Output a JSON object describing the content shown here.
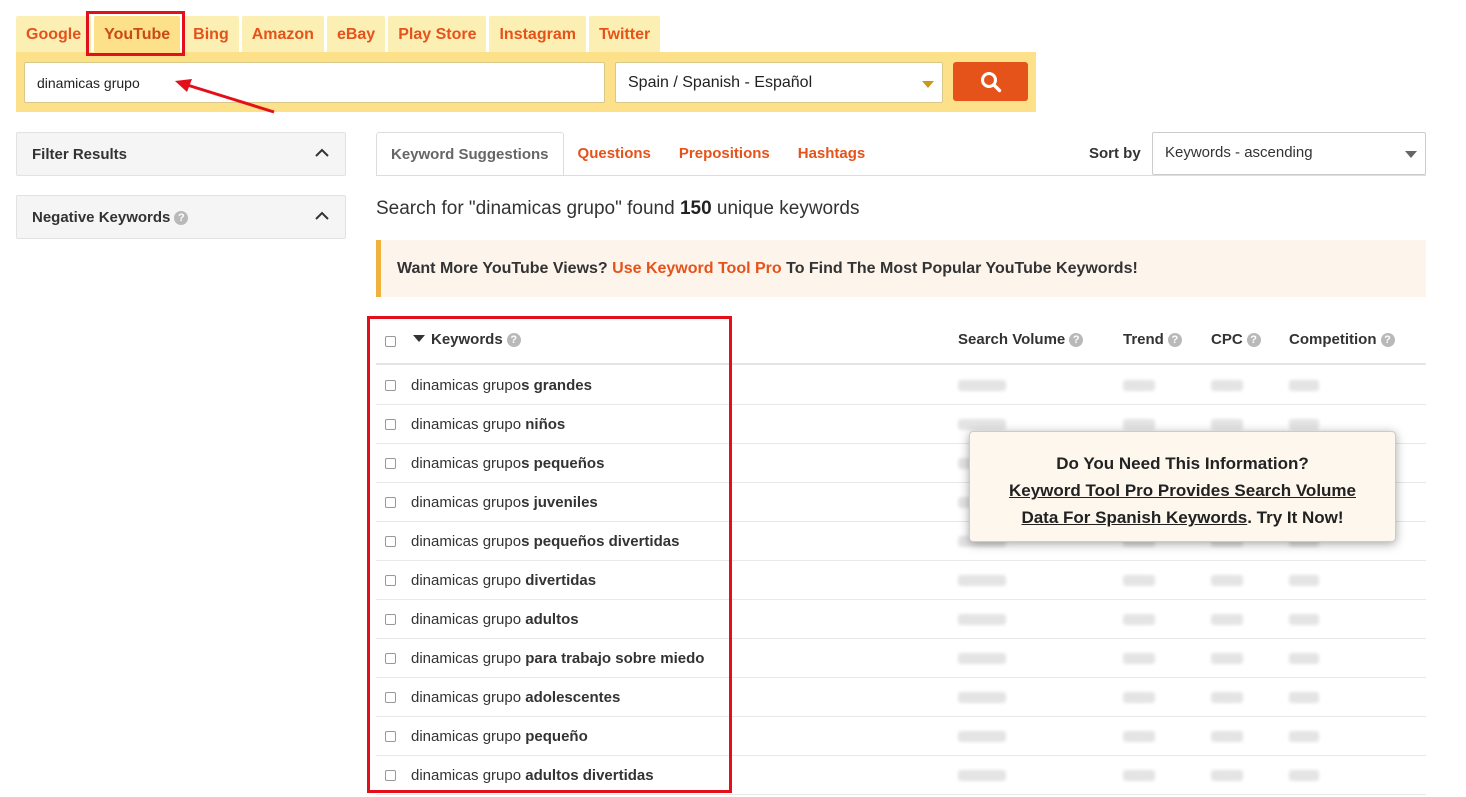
{
  "tabs": [
    "Google",
    "YouTube",
    "Bing",
    "Amazon",
    "eBay",
    "Play Store",
    "Instagram",
    "Twitter"
  ],
  "active_tab_index": 1,
  "search": {
    "value": "dinamicas grupo",
    "language": "Spain / Spanish - Español"
  },
  "sidebar": {
    "filter_title": "Filter Results",
    "negative_title": "Negative Keywords"
  },
  "result_tabs": [
    "Keyword Suggestions",
    "Questions",
    "Prepositions",
    "Hashtags"
  ],
  "sort": {
    "label": "Sort by",
    "value": "Keywords - ascending"
  },
  "found": {
    "prefix": "Search for \"dinamicas grupo\" found ",
    "count": "150",
    "suffix": " unique keywords"
  },
  "promo": {
    "text1": "Want More YouTube Views? ",
    "link": "Use Keyword Tool Pro",
    "text2": " To Find The Most Popular YouTube Keywords!"
  },
  "table": {
    "headers": {
      "keywords": "Keywords",
      "volume": "Search Volume",
      "trend": "Trend",
      "cpc": "CPC",
      "competition": "Competition"
    },
    "rows": [
      {
        "base": "dinamicas grupo",
        "bold": "s grandes"
      },
      {
        "base": "dinamicas grupo ",
        "bold": "niños"
      },
      {
        "base": "dinamicas grupo",
        "bold": "s pequeños"
      },
      {
        "base": "dinamicas grupo",
        "bold": "s juveniles"
      },
      {
        "base": "dinamicas grupo",
        "bold": "s pequeños divertidas"
      },
      {
        "base": "dinamicas grupo ",
        "bold": "divertidas"
      },
      {
        "base": "dinamicas grupo ",
        "bold": "adultos"
      },
      {
        "base": "dinamicas grupo ",
        "bold": "para trabajo sobre miedo"
      },
      {
        "base": "dinamicas grupo ",
        "bold": "adolescentes"
      },
      {
        "base": "dinamicas grupo ",
        "bold": "pequeño"
      },
      {
        "base": "dinamicas grupo ",
        "bold": "adultos divertidas"
      }
    ]
  },
  "popup": {
    "line1": "Do You Need This Information?",
    "line2": "Keyword Tool Pro Provides Search Volume",
    "line3_link": "Data For Spanish Keywords",
    "line3_rest": ". Try It Now!"
  },
  "colors": {
    "accent": "#e5531b",
    "tab_bg": "#fcefb4",
    "searchbar_bg": "#fce08a",
    "highlight": "#e3101b"
  },
  "icons": [
    "search-icon",
    "chevron-up-icon",
    "help-icon",
    "dropdown-caret-icon",
    "sort-desc-icon",
    "annotation-arrow"
  ]
}
